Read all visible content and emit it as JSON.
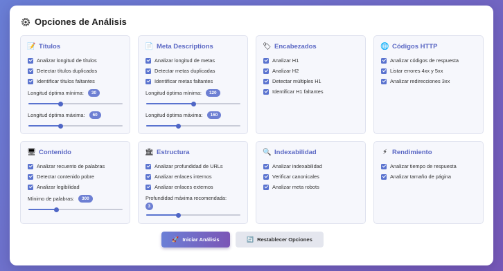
{
  "title": "Opciones de Análisis",
  "colors": {
    "accent": "#5a73cf",
    "heading": "#5b68c4",
    "background": "#6a7fd6"
  },
  "cards": [
    {
      "icon": "notepad-icon",
      "title": "Títulos",
      "options": [
        "Analizar longitud de títulos",
        "Detectar títulos duplicados",
        "Identificar títulos faltantes"
      ],
      "sliders": [
        {
          "label": "Longitud óptima mínima:",
          "value": "30",
          "fraction": 0.34
        },
        {
          "label": "Longitud óptima máxima:",
          "value": "60",
          "fraction": 0.34
        }
      ]
    },
    {
      "icon": "document-icon",
      "title": "Meta Descriptions",
      "options": [
        "Analizar longitud de metas",
        "Detectar metas duplicadas",
        "Identificar metas faltantes"
      ],
      "sliders": [
        {
          "label": "Longitud óptima mínima:",
          "value": "120",
          "fraction": 0.5
        },
        {
          "label": "Longitud óptima máxima:",
          "value": "160",
          "fraction": 0.34
        }
      ]
    },
    {
      "icon": "tag-icon",
      "title": "Encabezados",
      "options": [
        "Analizar H1",
        "Analizar H2",
        "Detectar múltiples H1",
        "Identificar H1 faltantes"
      ],
      "sliders": []
    },
    {
      "icon": "globe-icon",
      "title": "Códigos HTTP",
      "options": [
        "Analizar códigos de respuesta",
        "Listar errores 4xx y 5xx",
        "Analizar redirecciones 3xx"
      ],
      "sliders": []
    },
    {
      "icon": "monitor-icon",
      "title": "Contenido",
      "options": [
        "Analizar recuento de palabras",
        "Detectar contenido pobre",
        "Analizar legibilidad"
      ],
      "sliders": [
        {
          "label": "Mínimo de palabras:",
          "value": "300",
          "fraction": 0.3
        }
      ]
    },
    {
      "icon": "building-icon",
      "title": "Estructura",
      "options": [
        "Analizar profundidad de URLs",
        "Analizar enlaces internos",
        "Analizar enlaces externos"
      ],
      "sliders": [
        {
          "label": "Profundidad máxima recomendada:",
          "value": "3",
          "fraction": 0.34,
          "stacked": true
        }
      ]
    },
    {
      "icon": "magnifier-icon",
      "title": "Indexabilidad",
      "options": [
        "Analizar indexabilidad",
        "Verificar canonicales",
        "Analizar meta robots"
      ],
      "sliders": []
    },
    {
      "icon": "lightning-icon",
      "title": "Rendimiento",
      "options": [
        "Analizar tiempo de respuesta",
        "Analizar tamaño de página"
      ],
      "sliders": []
    }
  ],
  "buttons": {
    "start": "Iniciar Análisis",
    "reset": "Restablecer Opciones"
  }
}
